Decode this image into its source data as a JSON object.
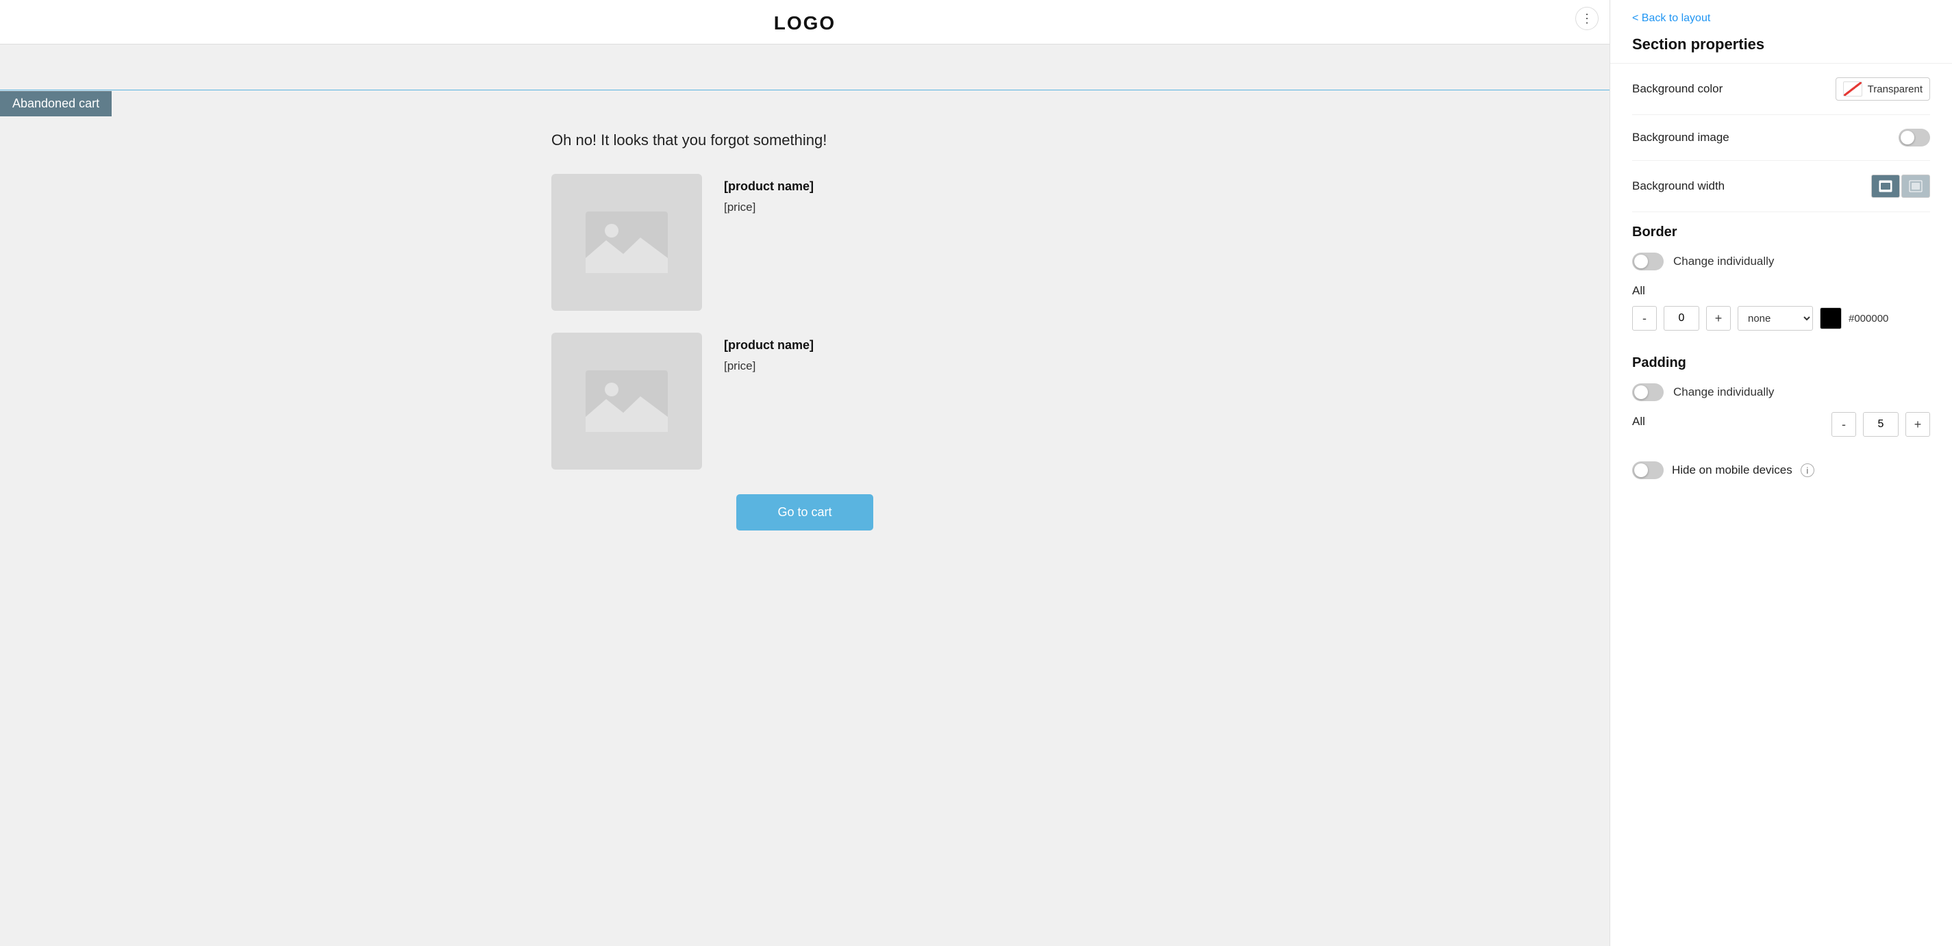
{
  "preview": {
    "logo": "LOGO",
    "abandoned_cart_tab": "Abandoned cart",
    "headline": "Oh no! It looks that you forgot something!",
    "product1": {
      "name": "[product name]",
      "price": "[price]"
    },
    "product2": {
      "name": "[product name]",
      "price": "[price]"
    },
    "go_to_cart_btn": "Go to cart"
  },
  "panel": {
    "back_to_layout": "< Back to layout",
    "section_title": "Section properties",
    "background_color_label": "Background color",
    "background_color_value": "Transparent",
    "background_image_label": "Background image",
    "background_width_label": "Background width",
    "border_label": "Border",
    "change_individually_label_1": "Change individually",
    "all_label_1": "All",
    "border_value": "0",
    "border_style": "none",
    "border_color_hex": "#000000",
    "padding_label": "Padding",
    "change_individually_label_2": "Change individually",
    "all_label_2": "All",
    "padding_value": "5",
    "hide_mobile_label": "Hide on mobile devices",
    "minus_label": "-",
    "plus_label": "+"
  }
}
